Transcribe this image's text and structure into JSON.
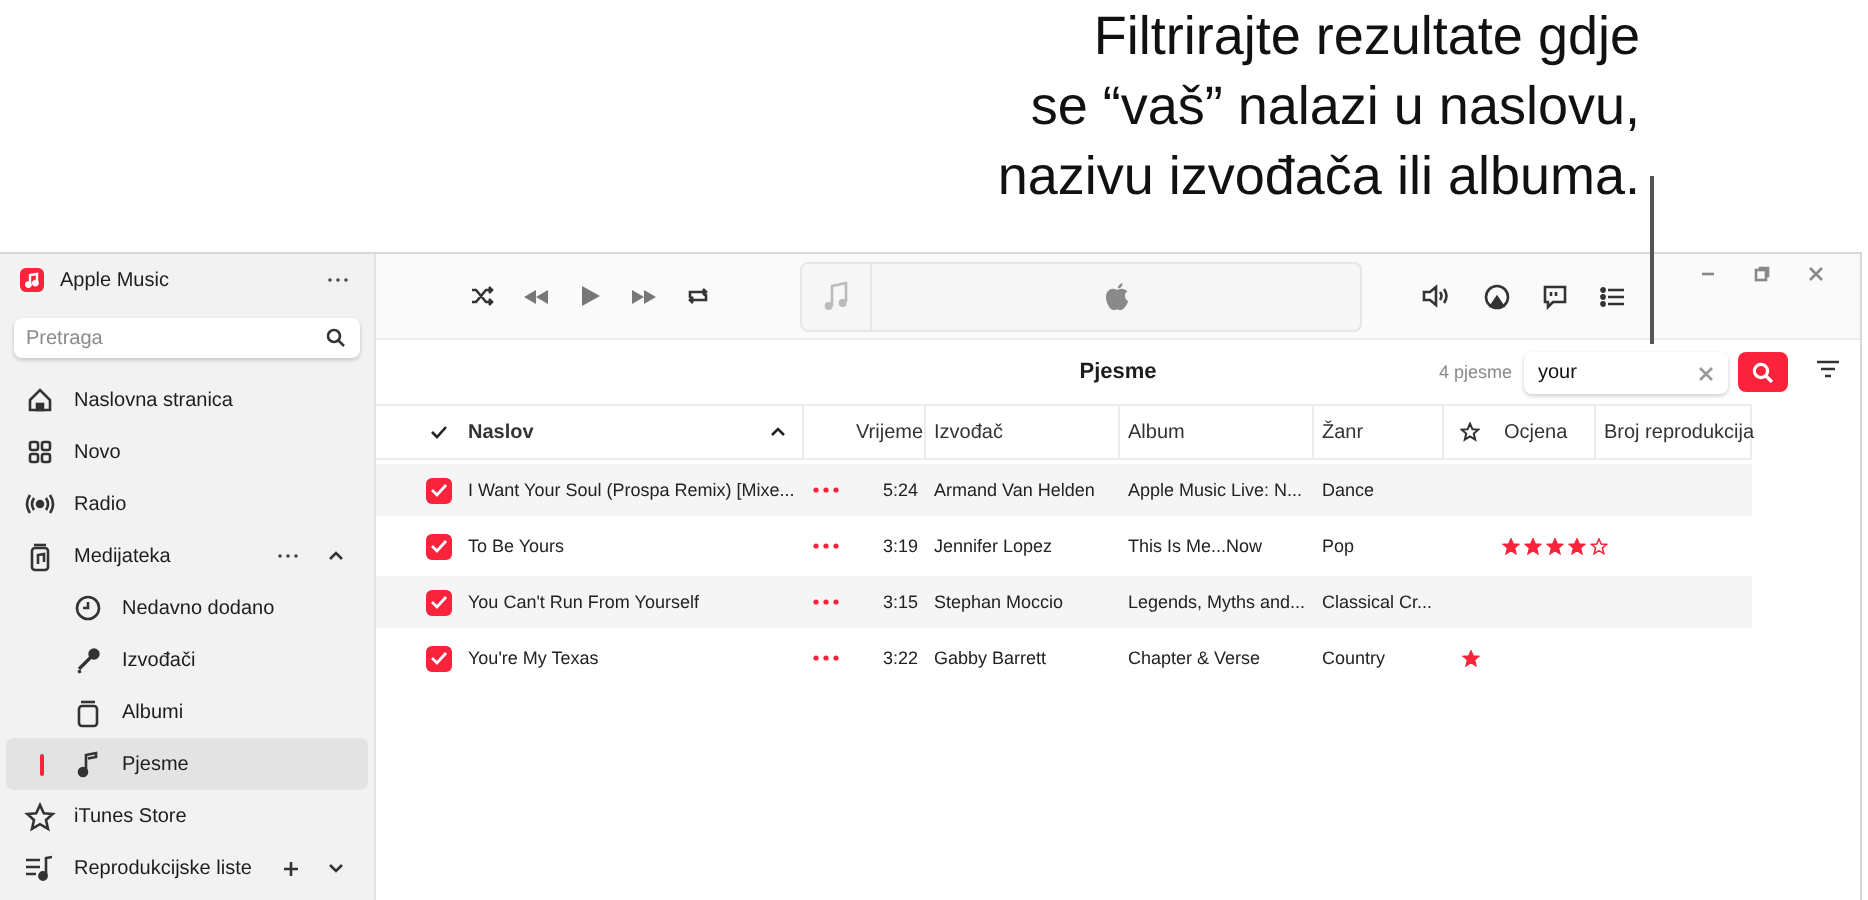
{
  "callout": {
    "lines": [
      "Filtrirajte rezultate gdje",
      "se “vaš” nalazi u naslovu,",
      "nazivu izvođača ili albuma."
    ]
  },
  "sidebar": {
    "app_title": "Apple Music",
    "search": {
      "placeholder": "Pretraga"
    },
    "items": [
      {
        "label": "Naslovna stranica",
        "kind": "home",
        "selected": false
      },
      {
        "label": "Novo",
        "kind": "grid",
        "selected": false
      },
      {
        "label": "Radio",
        "kind": "radio",
        "selected": false
      },
      {
        "label": "Medijateka",
        "kind": "library",
        "selected": false,
        "expanded": true,
        "children": [
          {
            "label": "Nedavno dodano",
            "kind": "clock",
            "selected": false
          },
          {
            "label": "Izvođači",
            "kind": "mic",
            "selected": false
          },
          {
            "label": "Albumi",
            "kind": "album",
            "selected": false
          },
          {
            "label": "Pjesme",
            "kind": "note",
            "selected": true
          }
        ]
      },
      {
        "label": "iTunes Store",
        "kind": "star",
        "selected": false
      },
      {
        "label": "Reprodukcijske liste",
        "kind": "playlist",
        "selected": false,
        "expanded": false
      }
    ]
  },
  "main": {
    "view_title": "Pjesme",
    "count": "4 pjesme",
    "filter": {
      "value": "your"
    },
    "table": {
      "columns": [
        "Naslov",
        "Vrijeme",
        "Izvođač",
        "Album",
        "Žanr",
        "Ocjena",
        "Broj reprodukcija"
      ],
      "rows": [
        {
          "checked": true,
          "title": "I Want Your Soul (Prospa Remix) [Mixe...",
          "time": "5:24",
          "artist": "Armand Van Helden",
          "album": "Apple Music Live: N...",
          "genre": "Dance",
          "favorite": false
        },
        {
          "checked": true,
          "title": "To Be Yours",
          "time": "3:19",
          "artist": "Jennifer Lopez",
          "album": "This Is Me...Now",
          "genre": "Pop",
          "favorite": false,
          "stars": 4
        },
        {
          "checked": true,
          "title": "You Can't Run From Yourself",
          "time": "3:15",
          "artist": "Stephan Moccio",
          "album": "Legends, Myths and...",
          "genre": "Classical Cr...",
          "favorite": false
        },
        {
          "checked": true,
          "title": "You're My Texas",
          "time": "3:22",
          "artist": "Gabby Barrett",
          "album": "Chapter & Verse",
          "genre": "Country",
          "favorite": true
        }
      ]
    }
  }
}
